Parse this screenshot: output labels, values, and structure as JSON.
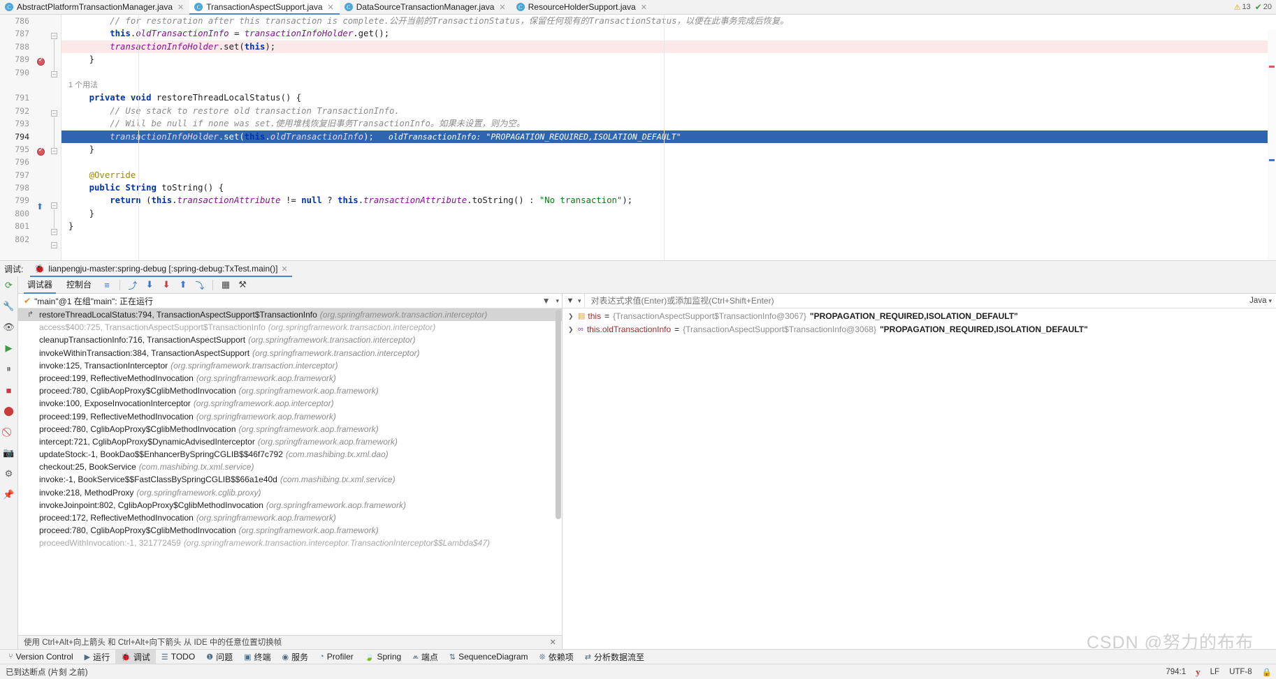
{
  "editor": {
    "tabs": [
      {
        "label": "AbstractPlatformTransactionManager.java",
        "icon": "java-class-icon",
        "active": false
      },
      {
        "label": "TransactionAspectSupport.java",
        "icon": "java-class-icon",
        "active": true
      },
      {
        "label": "DataSourceTransactionManager.java",
        "icon": "java-class-icon",
        "active": false
      },
      {
        "label": "ResourceHolderSupport.java",
        "icon": "java-class-icon",
        "active": false
      }
    ],
    "inspections": {
      "warning_count": "13",
      "ok_count": "20",
      "warning_icon": "warning-triangle-icon",
      "ok_icon": "checkmark-icon"
    },
    "lines": [
      {
        "num": "786",
        "text": "        // for restoration after this transaction is complete.公开当前的TransactionStatus，保留任何现有的TransactionStatus，以便在此事务完成后恢复。",
        "kind": "comment"
      },
      {
        "num": "787",
        "text": "        this.oldTransactionInfo = transactionInfoHolder.get();",
        "kind": "code"
      },
      {
        "num": "788",
        "text": "        transactionInfoHolder.set(this);",
        "kind": "code-breakpoint"
      },
      {
        "num": "789",
        "text": "    }",
        "kind": "code"
      },
      {
        "num": "790",
        "text": "",
        "kind": "blank"
      },
      {
        "num": "791",
        "text": "    private void restoreThreadLocalStatus() {",
        "kind": "code",
        "usage_hint": "1 个用法"
      },
      {
        "num": "792",
        "text": "        // Use stack to restore old transaction TransactionInfo.",
        "kind": "comment"
      },
      {
        "num": "793",
        "text": "        // Will be null if none was set.使用堆栈恢复旧事务TransactionInfo。如果未设置，则为空。",
        "kind": "comment"
      },
      {
        "num": "794",
        "text": "        transactionInfoHolder.set(this.oldTransactionInfo);",
        "kind": "code-executing",
        "inline_hint": "oldTransactionInfo: \"PROPAGATION_REQUIRED,ISOLATION_DEFAULT\""
      },
      {
        "num": "795",
        "text": "    }",
        "kind": "code"
      },
      {
        "num": "796",
        "text": "",
        "kind": "blank"
      },
      {
        "num": "797",
        "text": "    @Override",
        "kind": "annotation"
      },
      {
        "num": "798",
        "text": "    public String toString() {",
        "kind": "code"
      },
      {
        "num": "799",
        "text": "        return (this.transactionAttribute != null ? this.transactionAttribute.toString() : \"No transaction\");",
        "kind": "code"
      },
      {
        "num": "800",
        "text": "    }",
        "kind": "code"
      },
      {
        "num": "801",
        "text": "}",
        "kind": "code"
      },
      {
        "num": "802",
        "text": "",
        "kind": "blank"
      }
    ]
  },
  "debug_window": {
    "label": "调试:",
    "config_tab": "lianpengju-master:spring-debug [:spring-debug:TxTest.main()]",
    "config_icon": "bug-icon",
    "close_icon": "close-icon",
    "tabs": [
      {
        "label": "调试器",
        "active": true
      },
      {
        "label": "控制台",
        "active": false
      }
    ],
    "toolbar_icons": [
      "layout-icon",
      "step-over-icon",
      "step-into-icon",
      "force-step-into-icon",
      "step-out-icon",
      "run-to-cursor-icon",
      "evaluate-icon",
      "settings-icon"
    ],
    "rerun_icon": "rerun-icon"
  },
  "left_rail": {
    "icons": [
      "wrench-icon",
      "eye-icon",
      "resume-icon",
      "pause-icon",
      "stop-icon",
      "breakpoints-icon",
      "mute-breakpoints-icon",
      "camera-icon",
      "settings-gear-icon",
      "pin-icon"
    ]
  },
  "frames": {
    "thread_label": "\"main\"@1 在组\"main\": 正在运行",
    "thread_icon": "running-check-icon",
    "filter_icon": "filter-icon",
    "dropdown_icon": "chevron-down-icon",
    "hint": "使用 Ctrl+Alt+向上箭头 和 Ctrl+Alt+向下箭头 从 IDE 中的任意位置切换帧",
    "hint_close_icon": "close-icon",
    "items": [
      {
        "name": "restoreThreadLocalStatus:794, TransactionAspectSupport$TransactionInfo",
        "pkg": "(org.springframework.transaction.interceptor)",
        "selected": true,
        "dim": false,
        "icon": "current-frame-icon"
      },
      {
        "name": "access$400:725, TransactionAspectSupport$TransactionInfo",
        "pkg": "(org.springframework.transaction.interceptor)",
        "selected": false,
        "dim": true
      },
      {
        "name": "cleanupTransactionInfo:716, TransactionAspectSupport",
        "pkg": "(org.springframework.transaction.interceptor)",
        "selected": false,
        "dim": false
      },
      {
        "name": "invokeWithinTransaction:384, TransactionAspectSupport",
        "pkg": "(org.springframework.transaction.interceptor)",
        "selected": false,
        "dim": false
      },
      {
        "name": "invoke:125, TransactionInterceptor",
        "pkg": "(org.springframework.transaction.interceptor)",
        "selected": false,
        "dim": false
      },
      {
        "name": "proceed:199, ReflectiveMethodInvocation",
        "pkg": "(org.springframework.aop.framework)",
        "selected": false,
        "dim": false
      },
      {
        "name": "proceed:780, CglibAopProxy$CglibMethodInvocation",
        "pkg": "(org.springframework.aop.framework)",
        "selected": false,
        "dim": false
      },
      {
        "name": "invoke:100, ExposeInvocationInterceptor",
        "pkg": "(org.springframework.aop.interceptor)",
        "selected": false,
        "dim": false
      },
      {
        "name": "proceed:199, ReflectiveMethodInvocation",
        "pkg": "(org.springframework.aop.framework)",
        "selected": false,
        "dim": false
      },
      {
        "name": "proceed:780, CglibAopProxy$CglibMethodInvocation",
        "pkg": "(org.springframework.aop.framework)",
        "selected": false,
        "dim": false
      },
      {
        "name": "intercept:721, CglibAopProxy$DynamicAdvisedInterceptor",
        "pkg": "(org.springframework.aop.framework)",
        "selected": false,
        "dim": false
      },
      {
        "name": "updateStock:-1, BookDao$$EnhancerBySpringCGLIB$$46f7c792",
        "pkg": "(com.mashibing.tx.xml.dao)",
        "selected": false,
        "dim": false
      },
      {
        "name": "checkout:25, BookService",
        "pkg": "(com.mashibing.tx.xml.service)",
        "selected": false,
        "dim": false
      },
      {
        "name": "invoke:-1, BookService$$FastClassBySpringCGLIB$$66a1e40d",
        "pkg": "(com.mashibing.tx.xml.service)",
        "selected": false,
        "dim": false
      },
      {
        "name": "invoke:218, MethodProxy",
        "pkg": "(org.springframework.cglib.proxy)",
        "selected": false,
        "dim": false
      },
      {
        "name": "invokeJoinpoint:802, CglibAopProxy$CglibMethodInvocation",
        "pkg": "(org.springframework.aop.framework)",
        "selected": false,
        "dim": false
      },
      {
        "name": "proceed:172, ReflectiveMethodInvocation",
        "pkg": "(org.springframework.aop.framework)",
        "selected": false,
        "dim": false
      },
      {
        "name": "proceed:780, CglibAopProxy$CglibMethodInvocation",
        "pkg": "(org.springframework.aop.framework)",
        "selected": false,
        "dim": false
      },
      {
        "name": "proceedWithInvocation:-1, 321772459",
        "pkg": "(org.springframework.transaction.interceptor.TransactionInterceptor$$Lambda$47)",
        "selected": false,
        "dim": true
      }
    ]
  },
  "variables": {
    "watch_placeholder": "对表达式求值(Enter)或添加监视(Ctrl+Shift+Enter)",
    "language_chip": "Java",
    "language_chip_icon": "chevron-down-icon",
    "items": [
      {
        "expand_icon": "chevron-right-icon",
        "type_icon": "object-value-icon",
        "name": "this",
        "eq": "=",
        "type": "{TransactionAspectSupport$TransactionInfo@3067}",
        "value": "\"PROPAGATION_REQUIRED,ISOLATION_DEFAULT\""
      },
      {
        "expand_icon": "chevron-right-icon",
        "type_icon": "field-value-icon",
        "name": "this.oldTransactionInfo",
        "eq": "=",
        "type": "{TransactionAspectSupport$TransactionInfo@3068}",
        "value": "\"PROPAGATION_REQUIRED,ISOLATION_DEFAULT\""
      }
    ]
  },
  "tool_window_bar": {
    "items": [
      {
        "label": "Version Control",
        "icon": "branch-icon",
        "active": false
      },
      {
        "label": "运行",
        "icon": "run-icon",
        "active": false
      },
      {
        "label": "调试",
        "icon": "debug-icon",
        "active": true
      },
      {
        "label": "TODO",
        "icon": "todo-icon",
        "active": false
      },
      {
        "label": "问题",
        "icon": "problems-icon",
        "active": false
      },
      {
        "label": "终端",
        "icon": "terminal-icon",
        "active": false
      },
      {
        "label": "服务",
        "icon": "services-icon",
        "active": false
      },
      {
        "label": "Profiler",
        "icon": "profiler-icon",
        "active": false
      },
      {
        "label": "Spring",
        "icon": "spring-leaf-icon",
        "active": false
      },
      {
        "label": "端点",
        "icon": "endpoints-icon",
        "active": false
      },
      {
        "label": "SequenceDiagram",
        "icon": "sequence-diagram-icon",
        "active": false
      },
      {
        "label": "依赖项",
        "icon": "dependencies-icon",
        "active": false
      },
      {
        "label": "分析数据流至",
        "icon": "dataflow-icon",
        "active": false
      }
    ]
  },
  "status_bar": {
    "message": "已到达断点 (片刻 之前)",
    "caret_position": "794:1",
    "indent_badge": "y",
    "line_separator": "LF",
    "encoding": "UTF-8",
    "lock_icon": "lock-icon"
  },
  "watermark": "CSDN @努力的布布"
}
